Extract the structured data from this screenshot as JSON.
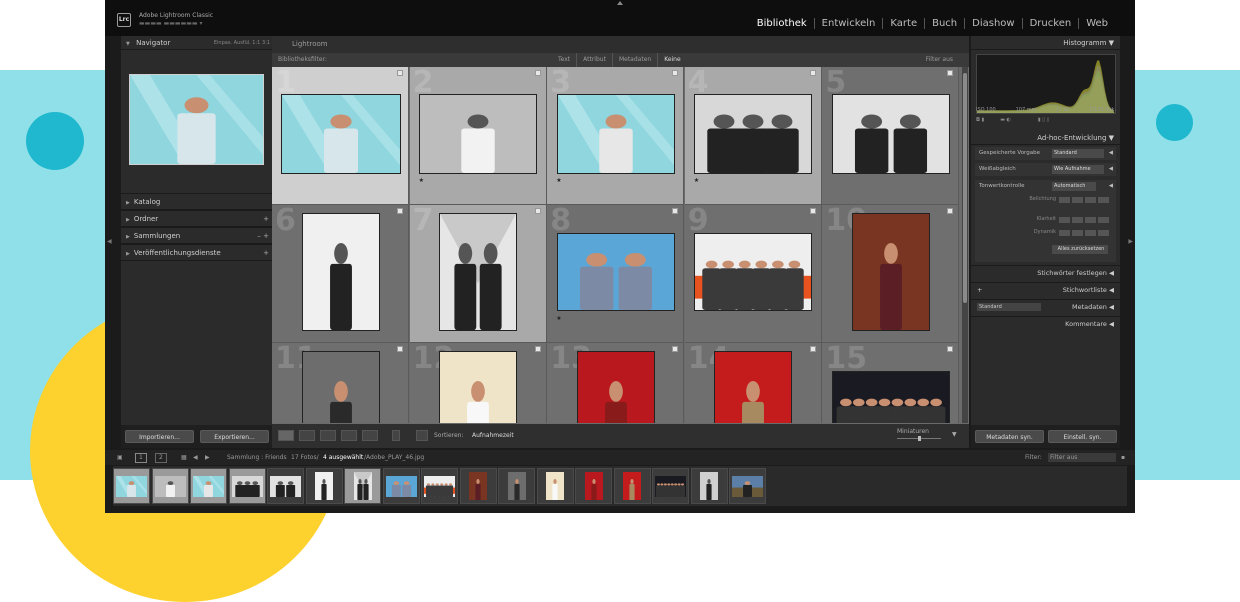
{
  "app": {
    "name": "Adobe Lightroom Classic",
    "logo": "Lrc",
    "modules": [
      "Bibliothek",
      "Entwickeln",
      "Karte",
      "Buch",
      "Diashow",
      "Drucken",
      "Web"
    ],
    "active_module": "Bibliothek"
  },
  "left_panel": {
    "navigator": "Navigator",
    "navigator_options": "Einpas.  Ausfül.  1:1  3:1",
    "sections": [
      "Katalog",
      "Ordner",
      "Sammlungen",
      "Veröffentlichungsdienste"
    ],
    "import_label": "Importieren...",
    "export_label": "Exportieren..."
  },
  "center": {
    "title": "Lightroom",
    "filter_label": "Bibliotheksfilter:",
    "filter_modes": [
      "Text",
      "Attribut",
      "Metadaten",
      "Keine"
    ],
    "active_filter_mode": "Keine",
    "filter_preset": "Filter aus",
    "sort_label": "Sortieren:",
    "sort_value": "Aufnahmezeit",
    "thumb_size_label": "Miniaturen"
  },
  "grid": [
    {
      "num": "1",
      "style": "teal-woman",
      "star": "",
      "sel": "main"
    },
    {
      "num": "2",
      "style": "gray-woman",
      "star": "★",
      "sel": "sel"
    },
    {
      "num": "3",
      "style": "teal-woman2",
      "star": "★",
      "sel": "sel"
    },
    {
      "num": "4",
      "style": "bw-group",
      "star": "★",
      "sel": "sel"
    },
    {
      "num": "5",
      "style": "bw-duo",
      "star": "",
      "sel": ""
    },
    {
      "num": "6",
      "style": "bw-man",
      "star": "",
      "sel": ""
    },
    {
      "num": "7",
      "style": "bw-pair",
      "star": "",
      "sel": "sel"
    },
    {
      "num": "8",
      "style": "blue-pair",
      "star": "★",
      "sel": ""
    },
    {
      "num": "9",
      "style": "color-band",
      "star": "",
      "sel": ""
    },
    {
      "num": "10",
      "style": "wood-man",
      "star": "",
      "sel": ""
    },
    {
      "num": "11",
      "style": "yellow-man",
      "star": "",
      "sel": ""
    },
    {
      "num": "12",
      "style": "cream-woman",
      "star": "",
      "sel": ""
    },
    {
      "num": "13",
      "style": "red-woman",
      "star": "",
      "sel": ""
    },
    {
      "num": "14",
      "style": "red-man",
      "star": "",
      "sel": ""
    },
    {
      "num": "15",
      "style": "night-group",
      "star": "",
      "sel": ""
    }
  ],
  "right_panel": {
    "histogram": "Histogramm",
    "histo_meta": [
      "ISO 100",
      "107 mm",
      "ƒ / 10",
      "1/125 Sek."
    ],
    "quick_develop": "Ad-hoc-Entwicklung",
    "saved_preset_label": "Gespeicherte Vorgabe",
    "saved_preset_value": "Standard",
    "wb_label": "Weißabgleich",
    "wb_value": "Wie Aufnahme",
    "tone_label": "Tonwertkontrolle",
    "auto_label": "Automatisch",
    "exposure_label": "Belichtung",
    "clarity_label": "Klarheit",
    "vibrance_label": "Dynamik",
    "reset_label": "Alles zurücksetzen",
    "keywording": "Stichwörter festlegen",
    "keyword_list": "Stichwortliste",
    "metadata_preset": "Standard",
    "metadata": "Metadaten",
    "comments": "Kommentare",
    "sync_meta": "Metadaten syn.",
    "sync_settings": "Einstell. syn."
  },
  "filmstrip": {
    "page1": "1",
    "page2": "2",
    "source": "Sammlung : Friends",
    "count": "17 Fotos/",
    "selected": "4 ausgewählt",
    "file": "/Adobe_PLAY_46.jpg",
    "filter_label": "Filter:",
    "filter_value": "Filter aus",
    "thumbs": [
      "teal-woman",
      "gray-woman",
      "teal-woman2",
      "bw-group",
      "bw-duo",
      "bw-man",
      "bw-pair",
      "blue-pair",
      "color-band",
      "wood-man",
      "yellow-man",
      "cream-woman",
      "red-woman",
      "red-man",
      "night-group",
      "bw-man2",
      "landscape"
    ]
  },
  "colors": {
    "accent_teal": "#7fd6dc",
    "background_band": "#8fe0e8",
    "circle_yellow": "#fdd22e"
  }
}
